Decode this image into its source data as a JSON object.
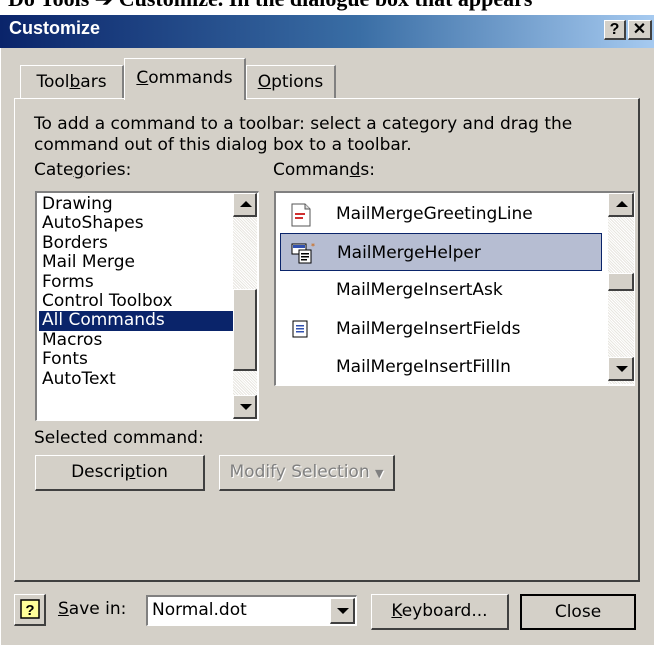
{
  "page_hint": "Do Tools ➔ Customize. In the dialogue box that appears",
  "dialog": {
    "title": "Customize",
    "help_caption_button": "?",
    "close_caption_button": "✕"
  },
  "tabs": [
    {
      "label": "Toolbars",
      "active": false
    },
    {
      "label": "Commands",
      "active": true
    },
    {
      "label": "Options",
      "active": false
    }
  ],
  "instructions": "To add a command to a toolbar: select a category and drag the command out of this dialog box to a toolbar.",
  "categories": {
    "label": "Categories:",
    "items": [
      "Drawing",
      "AutoShapes",
      "Borders",
      "Mail Merge",
      "Forms",
      "Control Toolbox",
      "All Commands",
      "Macros",
      "Fonts",
      "AutoText"
    ],
    "selected": "All Commands"
  },
  "commands": {
    "label": "Commands:",
    "items": [
      {
        "label": "MailMergeGreetingLine",
        "icon": "greeting-line-icon"
      },
      {
        "label": "MailMergeHelper",
        "icon": "mail-merge-helper-icon",
        "selected": true
      },
      {
        "label": "MailMergeInsertAsk",
        "icon": ""
      },
      {
        "label": "MailMergeInsertFields",
        "icon": "insert-fields-icon"
      },
      {
        "label": "MailMergeInsertFillIn",
        "icon": ""
      }
    ]
  },
  "selected_command": {
    "label": "Selected command:",
    "description_button": "Description",
    "modify_selection_button": "Modify Selection"
  },
  "footer": {
    "save_in_label": "Save in:",
    "save_in_value": "Normal.dot",
    "keyboard_button": "Keyboard...",
    "close_button": "Close"
  },
  "colors": {
    "title_bar_start": "#0a246a",
    "title_bar_end": "#a6caf0",
    "dialog_face": "#d4d0c8",
    "selection": "#0a246a",
    "command_highlight": "#b6bdd2"
  }
}
